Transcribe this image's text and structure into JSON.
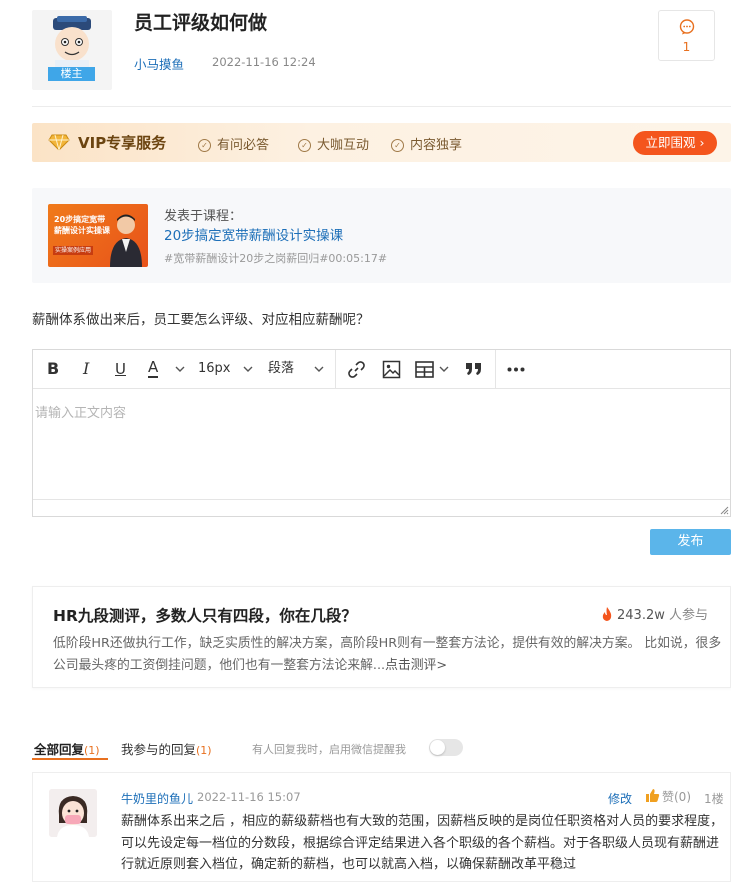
{
  "post": {
    "title": "员工评级如何做",
    "author": "小马摸鱼",
    "time": "2022-11-16 12:24",
    "owner_badge": "楼主",
    "comment_count": "1"
  },
  "vip": {
    "title": "VIP专享服务",
    "features": [
      "有问必答",
      "大咖互动",
      "内容独享"
    ],
    "cta": "立即围观"
  },
  "course": {
    "label": "发表于课程：",
    "name": "20步搞定宽带薪酬设计实操课",
    "tag": "#宽带薪酬设计20步之岗薪回归#00:05:17#",
    "thumb_line1": "20步搞定宽带",
    "thumb_line2": "薪酬设计实操课",
    "thumb_badge": "实操案例应用"
  },
  "question": "薪酬体系做出来后，员工要怎么评级、对应相应薪酬呢？",
  "editor": {
    "font_size": "16px",
    "paragraph": "段落",
    "placeholder": "请输入正文内容"
  },
  "publish_label": "发布",
  "promo": {
    "title": "HR九段测评，多数人只有四段，你在几段？",
    "count": "243.2w",
    "count_suffix": "人参与",
    "body": "低阶段HR还做执行工作，缺乏实质性的解决方案，高阶段HR则有一整套方法论，提供有效的解决方案。 比如说，很多公司最头疼的工资倒挂问题，他们也有一整套方法论来解...",
    "link": "点击测评>"
  },
  "tabs": {
    "all_label": "全部回复",
    "all_count": "(1)",
    "mine_label": "我参与的回复",
    "mine_count": "(1)",
    "notify": "有人回复我时，启用微信提醒我"
  },
  "reply": {
    "user": "牛奶里的鱼儿",
    "time": "2022-11-16 15:07",
    "edit": "修改",
    "like": "赞(0)",
    "floor": "1楼",
    "body": "薪酬体系出来之后 ，相应的薪级薪档也有大致的范围，因薪档反映的是岗位任职资格对人员的要求程度，可以先设定每一档位的分数段，根据综合评定结果进入各个职级的各个薪档。对于各职级人员现有薪酬进行就近原则套入档位，确定新的薪档，也可以就高入档，以确保薪酬改革平稳过"
  },
  "colors": {
    "accent_orange": "#e8701f",
    "link_blue": "#1d6fb8",
    "publish_blue": "#5bb5ea",
    "vip_button": "#f4551d"
  }
}
